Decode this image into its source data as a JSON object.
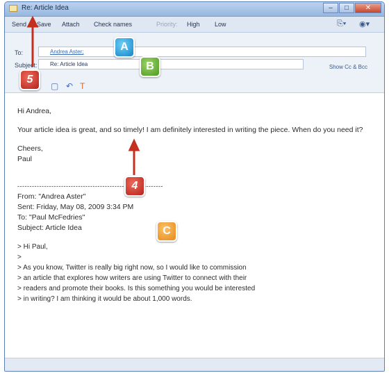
{
  "window": {
    "title": "Re: Article Idea"
  },
  "toolbar": {
    "send": "Send",
    "save": "Save",
    "attach": "Attach",
    "check_names": "Check names",
    "priority": "Priority:",
    "high": "High",
    "low": "Low"
  },
  "header": {
    "to_label": "To:",
    "to_value": "Andrea Aster;",
    "subject_label": "Subject:",
    "subject_value": "Re: Article Idea",
    "show_cc": "Show Cc & Bcc"
  },
  "body": {
    "greeting": "Hi Andrea,",
    "line1": "Your article idea is great, and so timely! I am definitely interested in writing the piece. When do you need it?",
    "closing": "Cheers,",
    "signature": "Paul",
    "separator": "------------------------------------------------------------",
    "from": "From: \"Andrea Aster\"",
    "sent": "Sent: Friday, May 08, 2009 3:34 PM",
    "to": "To: \"Paul McFedries\"",
    "subject": "Subject: Article Idea",
    "q1": "> Hi Paul,",
    "q2": ">",
    "q3": "> As you know, Twitter is really big right now, so I would like to commission",
    "q4": "> an article that explores how writers are using Twitter to connect with their",
    "q5": "> readers and promote their books. Is this something you would be interested",
    "q6": "> in writing? I am thinking it would be about 1,000 words."
  },
  "callouts": {
    "a": "A",
    "b": "B",
    "c": "C",
    "four": "4",
    "five": "5"
  },
  "colors": {
    "red": "#c4301f",
    "blue": "#1b8fd6",
    "green": "#5aa82a",
    "orange": "#f09a22"
  }
}
